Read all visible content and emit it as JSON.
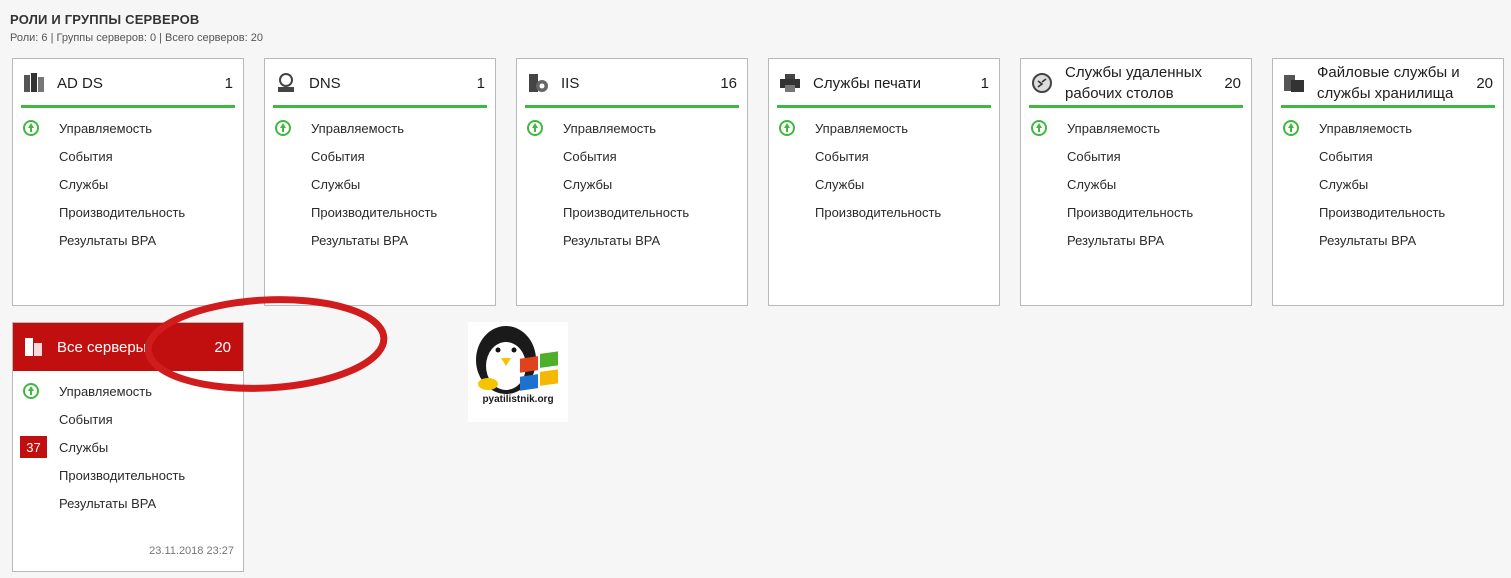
{
  "header": {
    "title": "РОЛИ И ГРУППЫ СЕРВЕРОВ",
    "summary": "Роли: 6 | Группы серверов: 0 | Всего серверов: 20"
  },
  "rows": {
    "manageability": "Управляемость",
    "events": "События",
    "services": "Службы",
    "performance": "Производительность",
    "bpa": "Результаты BPA"
  },
  "tiles": [
    {
      "title": "AD DS",
      "count": "1",
      "icon": "ad-ds-icon",
      "manageability_status": "online"
    },
    {
      "title": "DNS",
      "count": "1",
      "icon": "dns-icon",
      "manageability_status": "online"
    },
    {
      "title": "IIS",
      "count": "16",
      "icon": "iis-icon",
      "manageability_status": "online"
    },
    {
      "title": "Службы печати",
      "count": "1",
      "icon": "printer-icon",
      "manageability_status": "online"
    },
    {
      "title": "Службы удаленных рабочих столов",
      "count": "20",
      "icon": "remote-desktop-icon",
      "manageability_status": "online"
    },
    {
      "title": "Файловые службы и службы хранилища",
      "count": "20",
      "icon": "file-storage-icon",
      "manageability_status": "online"
    }
  ],
  "all_servers": {
    "title": "Все серверы",
    "count": "20",
    "services_alert_count": "37",
    "timestamp": "23.11.2018 23:27",
    "icon": "all-servers-icon"
  },
  "watermark": {
    "text": "pyatilistnik.org"
  },
  "colors": {
    "ok_green": "#3fb93f",
    "alert_red": "#c10f0f",
    "background": "#f6f6f6"
  }
}
